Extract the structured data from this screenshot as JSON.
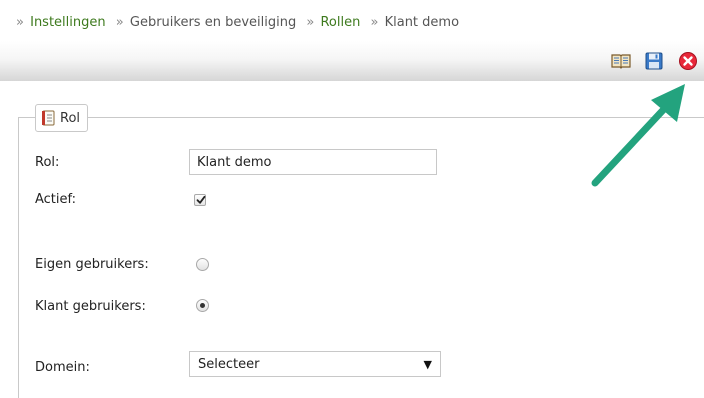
{
  "breadcrumb": {
    "items": [
      {
        "label": "Instellingen",
        "link": true
      },
      {
        "label": "Gebruikers en beveiliging",
        "link": false
      },
      {
        "label": "Rollen",
        "link": true
      },
      {
        "label": "Klant demo",
        "link": false
      }
    ],
    "separator": "»"
  },
  "toolbar": {
    "buttons": [
      "book-icon",
      "save-icon",
      "close-icon"
    ]
  },
  "form": {
    "section_title": "Rol",
    "fields": {
      "rol": {
        "label": "Rol:",
        "value": "Klant demo"
      },
      "actief": {
        "label": "Actief:",
        "checked": true
      },
      "eigen_gebruikers": {
        "label": "Eigen gebruikers:",
        "selected": false
      },
      "klant_gebruikers": {
        "label": "Klant gebruikers:",
        "selected": true
      },
      "domein": {
        "label": "Domein:",
        "value": "Selecteer",
        "caret": "▼"
      }
    }
  },
  "colors": {
    "link": "#3e7a1e",
    "annotation_arrow": "#23a37e",
    "close_red": "#e8283a",
    "save_blue": "#3a7ac8"
  }
}
